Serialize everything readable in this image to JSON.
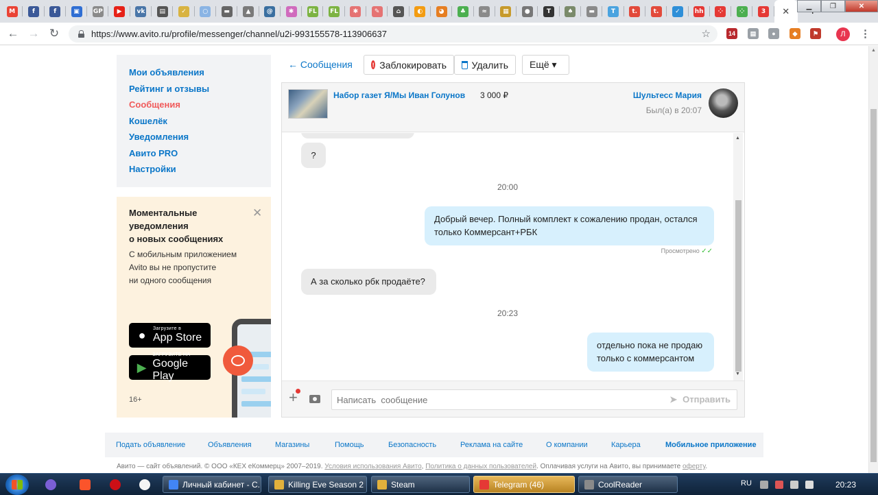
{
  "tabs": [
    {
      "icon": "gmail-icon",
      "color": "#ea4335",
      "glyph": "M"
    },
    {
      "icon": "facebook-icon",
      "color": "#3b5998",
      "glyph": "f"
    },
    {
      "icon": "facebook-icon",
      "color": "#3b5998",
      "glyph": "f"
    },
    {
      "icon": "messenger-icon",
      "color": "#2f6ed3",
      "glyph": "▣"
    },
    {
      "icon": "gp-icon",
      "color": "#8a8a8a",
      "glyph": "GP"
    },
    {
      "icon": "youtube-icon",
      "color": "#e62117",
      "glyph": "▶"
    },
    {
      "icon": "vk-icon",
      "color": "#4a76a8",
      "glyph": "vk"
    },
    {
      "icon": "book-icon",
      "color": "#555555",
      "glyph": "▤"
    },
    {
      "icon": "pin-icon",
      "color": "#d8b341",
      "glyph": "✓"
    },
    {
      "icon": "circle-icon",
      "color": "#8ab4e4",
      "glyph": "○"
    },
    {
      "icon": "chat-icon",
      "color": "#666666",
      "glyph": "▬"
    },
    {
      "icon": "mountain-icon",
      "color": "#7a7a7a",
      "glyph": "▲"
    },
    {
      "icon": "swirl-icon",
      "color": "#3a6fa0",
      "glyph": "@"
    },
    {
      "icon": "asterisk-icon",
      "color": "#d06bbd",
      "glyph": "✱"
    },
    {
      "icon": "fl-icon",
      "color": "#7cb342",
      "glyph": "FL"
    },
    {
      "icon": "fl-icon",
      "color": "#7cb342",
      "glyph": "FL"
    },
    {
      "icon": "asterisk-icon",
      "color": "#e57373",
      "glyph": "✱"
    },
    {
      "icon": "feather-icon",
      "color": "#e57373",
      "glyph": "✎"
    },
    {
      "icon": "home-icon",
      "color": "#555555",
      "glyph": "⌂"
    },
    {
      "icon": "pumpkin-icon",
      "color": "#f39c12",
      "glyph": "◐"
    },
    {
      "icon": "pie-icon",
      "color": "#e67e22",
      "glyph": "◕"
    },
    {
      "icon": "tree-icon",
      "color": "#4caf50",
      "glyph": "♣"
    },
    {
      "icon": "ribbon-icon",
      "color": "#8a8a8a",
      "glyph": "≈"
    },
    {
      "icon": "image-icon",
      "color": "#c79a2b",
      "glyph": "▦"
    },
    {
      "icon": "globe-icon",
      "color": "#777777",
      "glyph": "●"
    },
    {
      "icon": "t-icon",
      "color": "#333333",
      "glyph": "T"
    },
    {
      "icon": "tree-icon",
      "color": "#7a8a6a",
      "glyph": "♠"
    },
    {
      "icon": "hat-icon",
      "color": "#8a8a8a",
      "glyph": "▬"
    },
    {
      "icon": "t-icon",
      "color": "#4aa3df",
      "glyph": "T"
    },
    {
      "icon": "tumblr-icon",
      "color": "#e24a3b",
      "glyph": "t."
    },
    {
      "icon": "tumblr-icon",
      "color": "#e24a3b",
      "glyph": "t."
    },
    {
      "icon": "bird-icon",
      "color": "#2e8fd8",
      "glyph": "✓"
    },
    {
      "icon": "hh-icon",
      "color": "#e53935",
      "glyph": "hh"
    },
    {
      "icon": "dots-icon",
      "color": "#e53935",
      "glyph": "⁘"
    },
    {
      "icon": "dots-icon",
      "color": "#4caf50",
      "glyph": "⁘"
    },
    {
      "icon": "badge-icon",
      "color": "#e53935",
      "glyph": "3"
    }
  ],
  "url": "https://www.avito.ru/profile/messenger/channel/u2i-993155578-113906637",
  "extensions": [
    {
      "icon": "ext-badge-icon",
      "color": "#b8282d",
      "glyph": "14"
    },
    {
      "icon": "ext-doc-icon",
      "color": "#9aa0a6",
      "glyph": "▤"
    },
    {
      "icon": "ext-globe-icon",
      "color": "#9aa0a6",
      "glyph": "●"
    },
    {
      "icon": "ext-fox-icon",
      "color": "#e67e22",
      "glyph": "◆"
    },
    {
      "icon": "ext-flag-icon",
      "color": "#c0392b",
      "glyph": "⚑"
    }
  ],
  "profile_letter": "Л",
  "sidebar": {
    "items": [
      {
        "label": "Мои объявления",
        "active": false
      },
      {
        "label": "Рейтинг и отзывы",
        "active": false
      },
      {
        "label": "Сообщения",
        "active": true
      },
      {
        "label": "Кошелёк",
        "active": false
      },
      {
        "label": "Уведомления",
        "active": false
      },
      {
        "label": "Авито PRO",
        "active": false
      },
      {
        "label": "Настройки",
        "active": false
      }
    ]
  },
  "promo": {
    "title": "Моментальные уведомления о новых сообщениях",
    "title_lines": [
      "Моментальные",
      "уведомления",
      "о новых сообщениях"
    ],
    "text_lines": [
      "С мобильным приложением",
      "Avito вы не пропустите",
      "ни одного сообщения"
    ],
    "appstore": {
      "small": "Загрузите в",
      "big": "App Store"
    },
    "googleplay": {
      "small": "ЗАГРУЗИТЕ НА",
      "big": "Google Play"
    },
    "age": "16+"
  },
  "chat_toolbar": {
    "back": "← Сообщения",
    "block": "Заблокировать",
    "delete": "Удалить",
    "more": "Ещё ▾"
  },
  "chat": {
    "item_title": "Набор газет Я/Мы Иван Голунов",
    "price": "3 000 ₽",
    "seller": "Шультесс Мария",
    "last_seen": "Был(а) в 20:07",
    "messages": [
      {
        "dir": "in",
        "text": "?"
      },
      {
        "time": "20:00"
      },
      {
        "dir": "out",
        "lines": [
          "Добрый вечер. Полный комплект к сожалению продан, остался",
          "только Коммерсант+РБК"
        ]
      },
      {
        "dir": "in",
        "text": "А за сколько рбк продаёте?"
      },
      {
        "time": "20:23"
      },
      {
        "dir": "out",
        "lines": [
          "отдельно пока не продаю",
          "только с коммерсантом"
        ]
      }
    ],
    "viewed": "Просмотрено",
    "placeholder": "Написать  сообщение",
    "send": "Отправить"
  },
  "footer": {
    "links": [
      "Подать объявление",
      "Объявления",
      "Магазины",
      "Помощь",
      "Безопасность",
      "Реклама на сайте",
      "О компании",
      "Карьера",
      "Мобильное приложение"
    ],
    "copyright_prefix": "Авито — сайт объявлений. © ООО «КЕХ еКоммерц» 2007–2019.",
    "terms": "Условия использования Авито",
    "privacy": "Политика о данных пользователей",
    "copyright_mid": ". Оплачивая услуги на Авито, вы принимаете",
    "offer": "оферту",
    "copyright_end": "."
  },
  "taskbar": {
    "items": [
      {
        "label": "Личный кабинет - С...",
        "color": "#4285f4",
        "active": false
      },
      {
        "label": "Killing Eve Season 2 ...",
        "color": "#e2b13c",
        "active": false
      },
      {
        "label": "Steam",
        "color": "#e2b13c",
        "active": false
      },
      {
        "label": "Telegram (46)",
        "color": "#e53935",
        "active": true
      },
      {
        "label": "CoolReader",
        "color": "#8a8a8a",
        "active": false
      }
    ],
    "lang": "RU",
    "clock": "20:23"
  }
}
